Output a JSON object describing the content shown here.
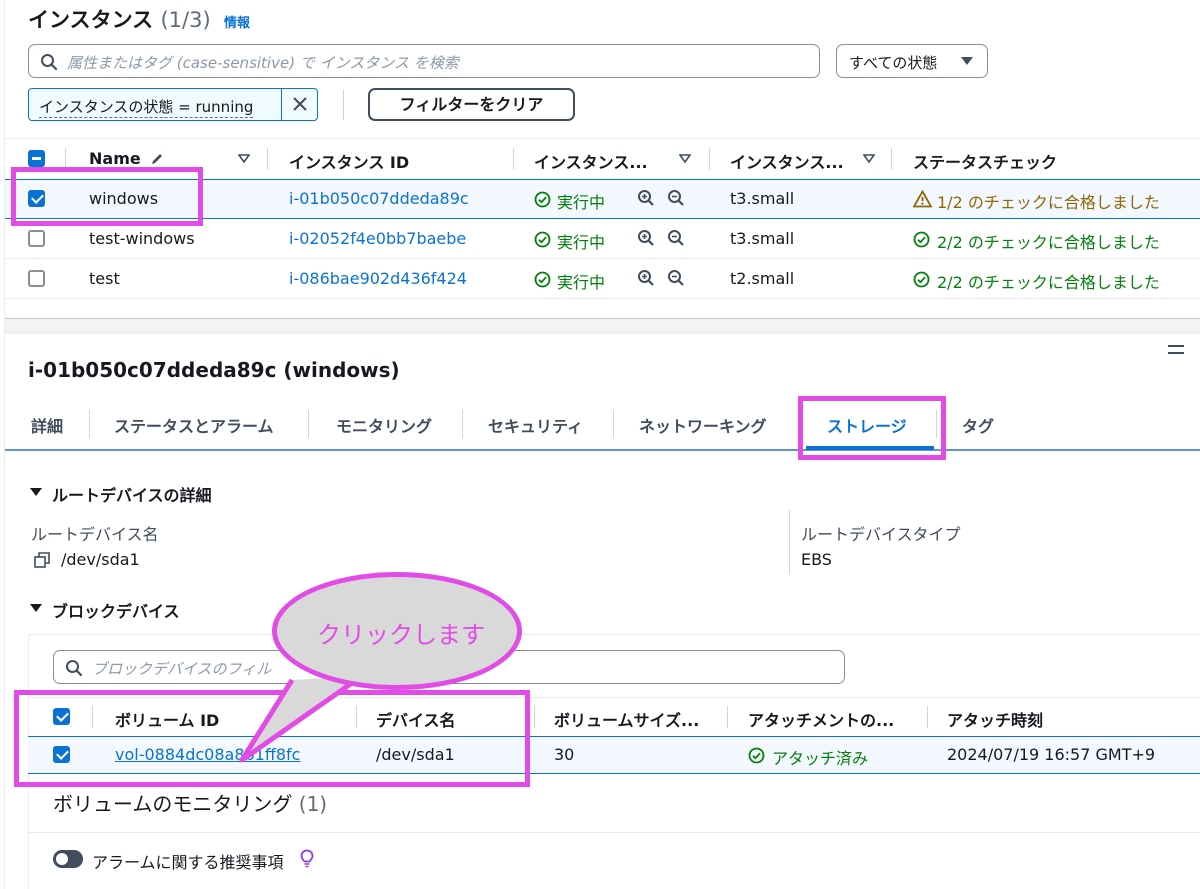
{
  "header": {
    "title": "インスタンス",
    "count": "(1/3)",
    "info": "情報"
  },
  "search": {
    "placeholder": "属性またはタグ (case-sensitive) で インスタンス を検索"
  },
  "state_filter": {
    "label": "すべての状態"
  },
  "filter_chip": {
    "label": "インスタンスの状態 = running"
  },
  "clear_filters": {
    "label": "フィルターをクリア"
  },
  "instances_table": {
    "headers": [
      "Name",
      "インスタンス ID",
      "インスタンス...",
      "インスタンス...",
      "ステータスチェック"
    ],
    "rows": [
      {
        "name": "windows",
        "id": "i-01b050c07ddeda89c",
        "state": "実行中",
        "type": "t3.small",
        "check": "1/2 のチェックに合格しました",
        "selected": true,
        "check_status": "warning"
      },
      {
        "name": "test-windows",
        "id": "i-02052f4e0bb7baebe",
        "state": "実行中",
        "type": "t3.small",
        "check": "2/2 のチェックに合格しました",
        "selected": false,
        "check_status": "ok"
      },
      {
        "name": "test",
        "id": "i-086bae902d436f424",
        "state": "実行中",
        "type": "t2.small",
        "check": "2/2 のチェックに合格しました",
        "selected": false,
        "check_status": "ok"
      }
    ]
  },
  "detail": {
    "title": "i-01b050c07ddeda89c (windows)",
    "tabs": [
      "詳細",
      "ステータスとアラーム",
      "モニタリング",
      "セキュリティ",
      "ネットワーキング",
      "ストレージ",
      "タグ"
    ],
    "active_tab": "ストレージ",
    "root_device": {
      "heading": "ルートデバイスの詳細",
      "name_label": "ルートデバイス名",
      "name_value": "/dev/sda1",
      "type_label": "ルートデバイスタイプ",
      "type_value": "EBS"
    },
    "block_devices": {
      "heading": "ブロックデバイス",
      "search_placeholder": "ブロックデバイスのフィル",
      "headers": [
        "ボリューム ID",
        "デバイス名",
        "ボリュームサイズ...",
        "アタッチメントの...",
        "アタッチ時刻"
      ],
      "row": {
        "volume_id": "vol-0884dc08a8b1ff8fc",
        "device": "/dev/sda1",
        "size": "30",
        "attachment": "アタッチ済み",
        "time": "2024/07/19 16:57 GMT+9"
      }
    },
    "monitoring": {
      "title": "ボリュームのモニタリング",
      "count": "(1)",
      "alarm_recommendation": "アラームに関する推奨事項"
    }
  },
  "callout": {
    "text": "クリックします"
  },
  "colors": {
    "accent": "#0972d3",
    "ok": "#037f0c",
    "warning": "#8d6605",
    "annotation": "#e24ce6"
  }
}
